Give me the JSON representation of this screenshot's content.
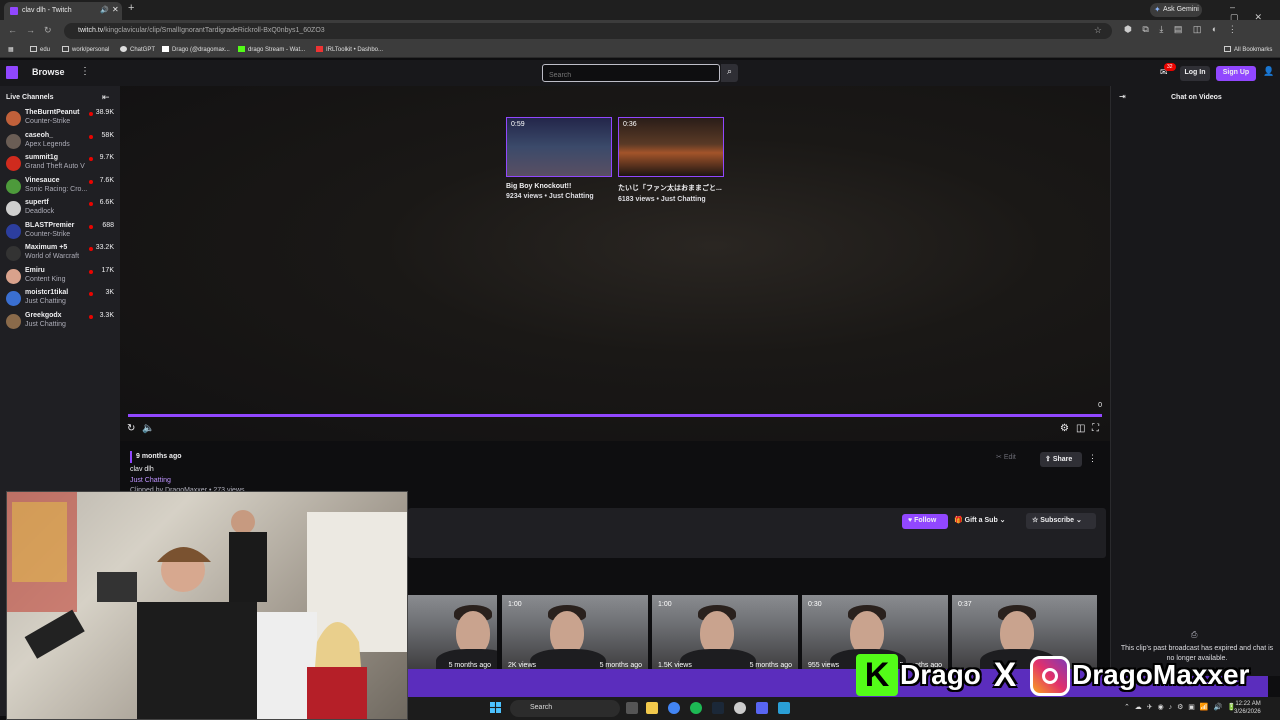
{
  "browser": {
    "tab_title": "clav dlh - Twitch",
    "new_tab": "+",
    "url_domain": "twitch.tv",
    "url_path": "/kingclavicular/clip/SmallIgnorantTardigradeRickroll-BxQ0nbys1_60ZO3",
    "ask_gemini": "Ask Gemini",
    "bookmarks": [
      "edu",
      "work/personal",
      "ChatGPT",
      "Drago (@dragomax...",
      "drago Stream - Wat...",
      "IRLToolkit • Dashbo..."
    ],
    "all_bookmarks": "All Bookmarks"
  },
  "twitch": {
    "browse": "Browse",
    "search_placeholder": "Search",
    "notif_count": "32",
    "login": "Log In",
    "signup": "Sign Up",
    "brand_color": "#9147ff"
  },
  "sidebar": {
    "title": "Live Channels",
    "channels": [
      {
        "name": "TheBurntPeanut",
        "game": "Counter-Strike",
        "viewers": "38.9K",
        "color": "#c0603a"
      },
      {
        "name": "caseoh_",
        "game": "Apex Legends",
        "viewers": "58K",
        "color": "#6a5d55"
      },
      {
        "name": "summit1g",
        "game": "Grand Theft Auto V",
        "viewers": "9.7K",
        "color": "#d02b1e"
      },
      {
        "name": "Vinesauce",
        "game": "Sonic Racing: Cro...",
        "viewers": "7.6K",
        "color": "#4d9a3b"
      },
      {
        "name": "supertf",
        "game": "Deadlock",
        "viewers": "6.6K",
        "color": "#cfcfcf"
      },
      {
        "name": "BLASTPremier",
        "game": "Counter-Strike",
        "viewers": "688",
        "color": "#2c3e9e"
      },
      {
        "name": "Maximum +5",
        "game": "World of Warcraft",
        "viewers": "33.2K",
        "color": "#333"
      },
      {
        "name": "Emiru",
        "game": "Content King",
        "viewers": "17K",
        "color": "#d9a28c"
      },
      {
        "name": "moistcr1tikal",
        "game": "Just Chatting",
        "viewers": "3K",
        "color": "#3a6fd1"
      },
      {
        "name": "Greekgodx",
        "game": "Just Chatting",
        "viewers": "3.3K",
        "color": "#8a6a4a"
      }
    ]
  },
  "player": {
    "recommended": [
      {
        "duration": "0:59",
        "title": "Big Boy Knockout!!",
        "meta": "9234 views • Just Chatting"
      },
      {
        "duration": "0:36",
        "title": "たいじ「ファン太はおままごと...",
        "meta": "6183 views • Just Chatting"
      }
    ],
    "time_remaining": "0"
  },
  "clip_info": {
    "ago": "9 months ago",
    "title": "clav dlh",
    "category": "Just Chatting",
    "clipped_by": "Clipped by DragoMaxxer • 273 views",
    "edit": "Edit",
    "share": "Share",
    "follow": "Follow",
    "gift": "Gift a Sub",
    "subscribe": "Subscribe"
  },
  "videos": [
    {
      "duration": "",
      "views": "",
      "ago": "5 months ago"
    },
    {
      "duration": "1:00",
      "views": "2K views",
      "ago": "5 months ago"
    },
    {
      "duration": "1:00",
      "views": "1.5K views",
      "ago": "5 months ago"
    },
    {
      "duration": "0:30",
      "views": "955 views",
      "ago": "5 months ago"
    },
    {
      "duration": "0:37",
      "views": "",
      "ago": ""
    }
  ],
  "chat": {
    "title": "Chat on Videos",
    "message": "This clip's past broadcast has expired and chat is no longer available."
  },
  "branding": {
    "kick_name": "Drago",
    "x_glyph": "X",
    "ig_name": "DragoMaxxer"
  },
  "taskbar": {
    "search": "Search",
    "time": "12:22 AM",
    "date": "3/26/2026"
  }
}
